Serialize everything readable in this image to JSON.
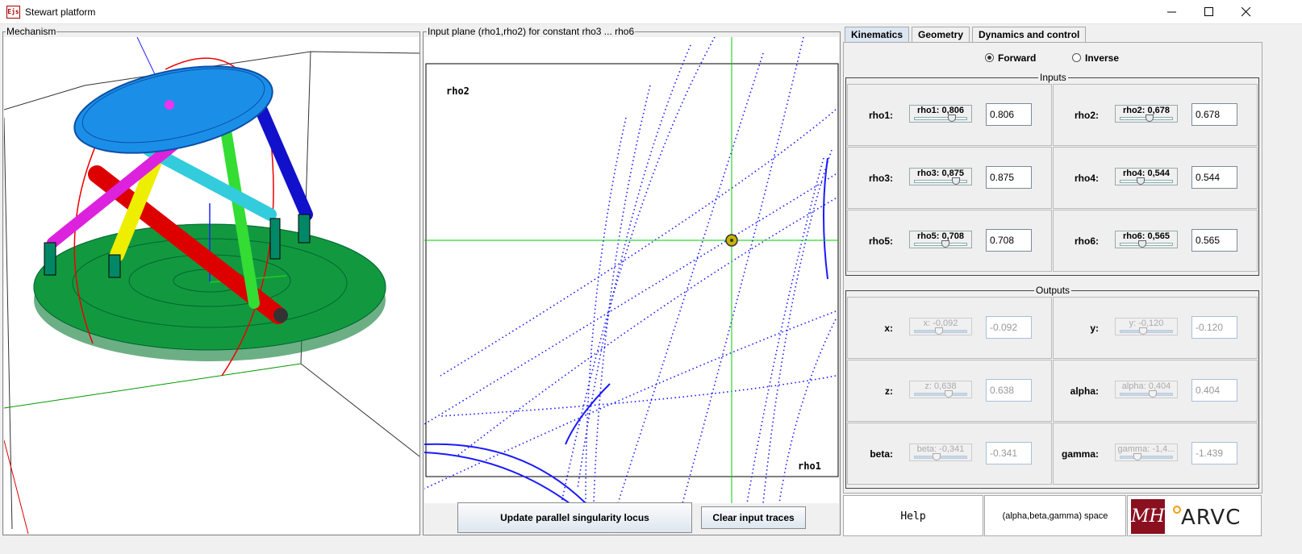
{
  "window": {
    "title": "Stewart platform",
    "icon_text": "Ejs"
  },
  "mechanism": {
    "label": "Mechanism"
  },
  "plane": {
    "label": "Input plane (rho1,rho2) for constant rho3 ... rho6",
    "ylabel": "rho2",
    "xlabel": "rho1",
    "update_button": "Update parallel singularity locus",
    "clear_button": "Clear input traces"
  },
  "tabs": [
    {
      "label": "Kinematics",
      "active": true
    },
    {
      "label": "Geometry",
      "active": false
    },
    {
      "label": "Dynamics and control",
      "active": false
    }
  ],
  "mode": {
    "forward": "Forward",
    "inverse": "Inverse",
    "selected": "Forward"
  },
  "inputs": {
    "title": "Inputs",
    "items": [
      {
        "label": "rho1:",
        "slider_text": "rho1: 0,806",
        "value": "0.806",
        "fraction": 0.72
      },
      {
        "label": "rho2:",
        "slider_text": "rho2: 0,678",
        "value": "0.678",
        "fraction": 0.55
      },
      {
        "label": "rho3:",
        "slider_text": "rho3: 0,875",
        "value": "0.875",
        "fraction": 0.8
      },
      {
        "label": "rho4:",
        "slider_text": "rho4: 0,544",
        "value": "0.544",
        "fraction": 0.36
      },
      {
        "label": "rho5:",
        "slider_text": "rho5: 0,708",
        "value": "0.708",
        "fraction": 0.58
      },
      {
        "label": "rho6:",
        "slider_text": "rho6: 0,565",
        "value": "0.565",
        "fraction": 0.4
      }
    ]
  },
  "outputs": {
    "title": "Outputs",
    "items": [
      {
        "label": "x:",
        "slider_text": "x: -0,092",
        "value": "-0.092",
        "fraction": 0.45
      },
      {
        "label": "y:",
        "slider_text": "y: -0,120",
        "value": "-0.120",
        "fraction": 0.42
      },
      {
        "label": "z:",
        "slider_text": "z: 0,638",
        "value": "0.638",
        "fraction": 0.65
      },
      {
        "label": "alpha:",
        "slider_text": "alpha: 0,404",
        "value": "0.404",
        "fraction": 0.62
      },
      {
        "label": "beta:",
        "slider_text": "beta: -0,341",
        "value": "-0.341",
        "fraction": 0.4
      },
      {
        "label": "gamma:",
        "slider_text": "gamma: -1,4...",
        "value": "-1.439",
        "fraction": 0.3
      }
    ]
  },
  "bottom": {
    "help": "Help",
    "space": "(alpha,beta,gamma) space",
    "logo1": "MH",
    "logo2": "ARVC"
  },
  "colors": {
    "accent": "#dbe6f2",
    "locus": "#1a1aff",
    "crosshair": "#00cc00"
  }
}
